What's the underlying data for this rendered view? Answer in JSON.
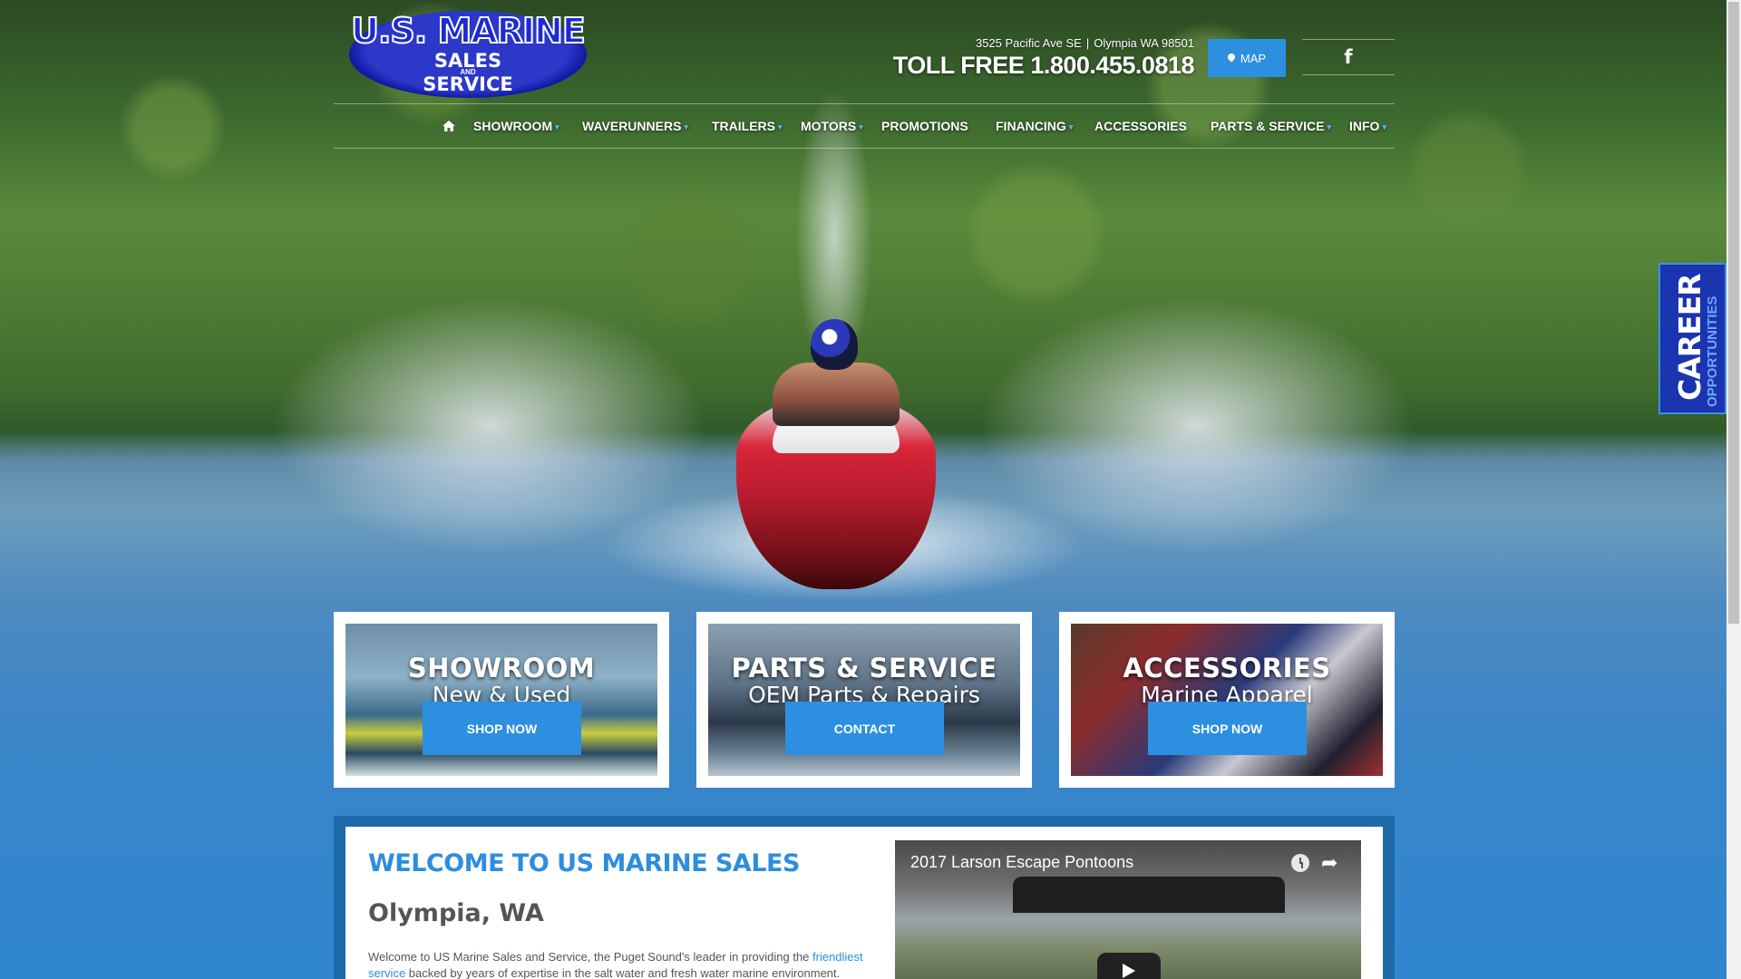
{
  "logo": {
    "line1": "U.S. MARINE",
    "line2": "SALES",
    "line3": "AND",
    "line4": "SERVICE"
  },
  "header": {
    "address_street": "3525 Pacific Ave SE",
    "address_separator": "|",
    "address_city": "Olympia WA 98501",
    "toll_free": "TOLL FREE 1.800.455.0818",
    "map_label": "MAP",
    "map_icon": "map-pin-icon",
    "social_icon": "facebook-icon",
    "social_glyph": "f"
  },
  "nav": {
    "home_icon": "home-icon",
    "items": [
      {
        "label": "SHOWROOM",
        "dropdown": true
      },
      {
        "label": "WAVERUNNERS",
        "dropdown": true
      },
      {
        "label": "TRAILERS",
        "dropdown": true
      },
      {
        "label": "MOTORS",
        "dropdown": true
      },
      {
        "label": "PROMOTIONS",
        "dropdown": false
      },
      {
        "label": "FINANCING",
        "dropdown": true
      },
      {
        "label": "ACCESSORIES",
        "dropdown": false
      },
      {
        "label": "PARTS & SERVICE",
        "dropdown": true
      },
      {
        "label": "INFO",
        "dropdown": true
      }
    ],
    "caret_glyph": "▾"
  },
  "career_tab": {
    "big": "CAREER",
    "small": "OPPORTUNITIES"
  },
  "cards": [
    {
      "title": "SHOWROOM",
      "subtitle": "New & Used",
      "button": "SHOP NOW"
    },
    {
      "title": "PARTS & SERVICE",
      "subtitle": "OEM Parts & Repairs",
      "button": "CONTACT"
    },
    {
      "title": "ACCESSORIES",
      "subtitle": "Marine Apparel",
      "button": "SHOP NOW"
    }
  ],
  "welcome": {
    "title": "WELCOME TO US MARINE SALES",
    "city": "Olympia, WA",
    "text_before": "Welcome to US Marine Sales and Service, the Puget Sound's leader in providing the ",
    "link": "friendliest service",
    "text_after": " backed by years of expertise in the salt water and fresh water marine environment."
  },
  "video": {
    "title": "2017 Larson Escape Pontoons",
    "watch_later_icon": "clock-icon",
    "share_icon": "share-icon",
    "share_glyph": "➦",
    "play_icon": "play-icon"
  },
  "colors": {
    "accent": "#2c8fe0",
    "career_bg": "#1b34b0",
    "welcome_title": "#2d8ddf"
  }
}
